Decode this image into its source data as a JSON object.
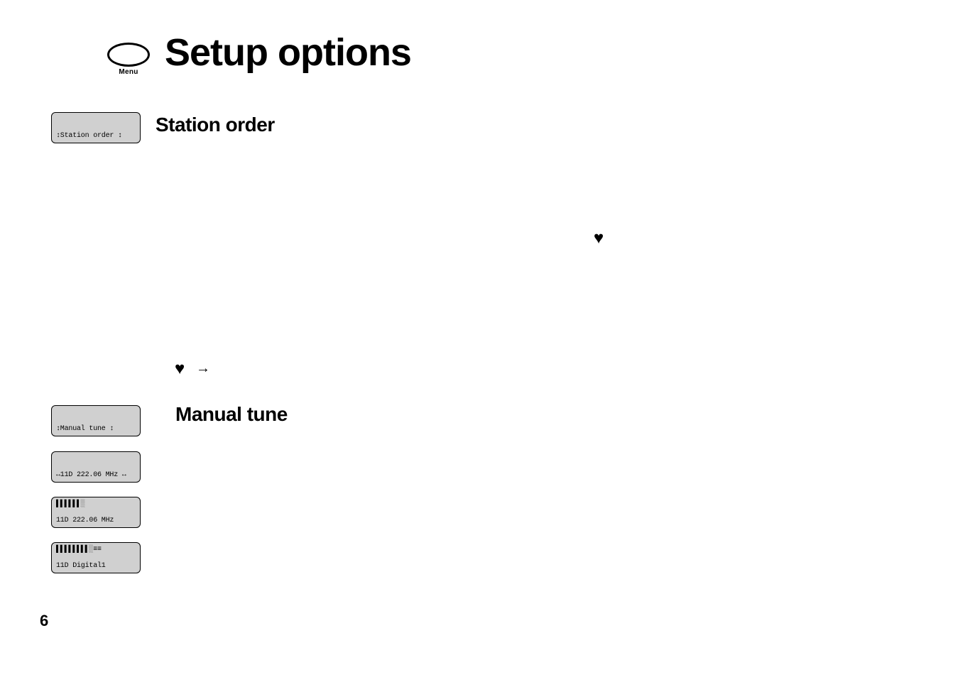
{
  "menu_button_label": "Menu",
  "page_title": "Setup options",
  "section_station_order": {
    "lcd_text": "↕Station order  ↕",
    "heading": "Station order"
  },
  "heart_glyph": "♥",
  "arrow_glyph": "→",
  "section_manual_tune": {
    "heading": "Manual tune",
    "lcd1": "↕Manual tune     ↕",
    "lcd2": "↔11D 222.06 MHz ↔",
    "lcd3_top": "▌▌▌▌▌▌░",
    "lcd3_bottom": " 11D 222.06 MHz",
    "lcd4_top": "▌▌▌▌▌▌▌▌░≡≡",
    "lcd4_bottom": " 11D Digital1"
  },
  "page_number": "6"
}
